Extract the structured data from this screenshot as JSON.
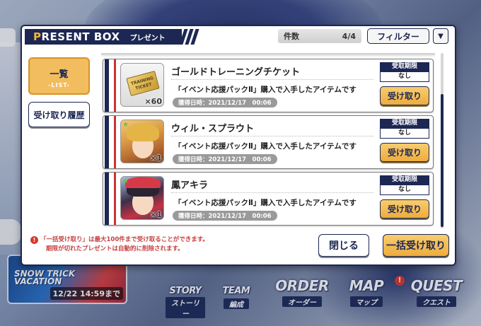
{
  "dialog": {
    "title_first_letter": "P",
    "title_rest": "RESENT BOX",
    "title_jp": "プレゼント",
    "count_label": "件数",
    "count_value": "4/4",
    "filter_label": "フィルター",
    "filter_arrow": "▼"
  },
  "tabs": {
    "list_label": "一覧",
    "list_sub": "-LIST-",
    "history_label": "受け取り履歴"
  },
  "items": [
    {
      "name": "ゴールドトレーニングチケット",
      "icon": "training-ticket-icon",
      "ticket_text": "TRAINING TICKET",
      "quantity": "×60",
      "description": "「イベント応援パックⅡ」購入で入手したアイテムです",
      "date": "獲得日時：2021/12/17　00:06",
      "deadline_label": "受取期限",
      "deadline_value": "なし",
      "button": "受け取り"
    },
    {
      "name": "ウィル・スプラウト",
      "icon": "character-card-icon",
      "quantity": "×1",
      "description": "「イベント応援パックⅡ」購入で入手したアイテムです",
      "date": "獲得日時：2021/12/17　00:06",
      "deadline_label": "受取期限",
      "deadline_value": "なし",
      "button": "受け取り"
    },
    {
      "name": "鳳アキラ",
      "icon": "character-card-icon",
      "quantity": "×1",
      "description": "「イベント応援パックⅡ」購入で入手したアイテムです",
      "date": "獲得日時：2021/12/17　00:06",
      "deadline_label": "受取期限",
      "deadline_value": "なし",
      "button": "受け取り"
    }
  ],
  "footer": {
    "notice_line1": "「一括受け取り」は最大100件まで受け取ることができます。",
    "notice_line2": "期限が切れたプレゼントは自動的に削除されます。",
    "close_label": "閉じる",
    "receive_all_label": "一括受け取り"
  },
  "background": {
    "event_title": "SNOW TRICK VACATION",
    "event_date": "12/22 14:59まで",
    "nav": [
      {
        "main": "STORY",
        "sub": "ストーリー"
      },
      {
        "main": "TEAM",
        "sub": "編成"
      },
      {
        "main": "ORDER",
        "sub": "オーダー"
      },
      {
        "main": "MAP",
        "sub": "マップ"
      },
      {
        "main": "QUEST",
        "sub": "クエスト"
      }
    ]
  },
  "colors": {
    "navy": "#1d2753",
    "gold": "#f1bd5e",
    "accent_red": "#cc3334"
  }
}
